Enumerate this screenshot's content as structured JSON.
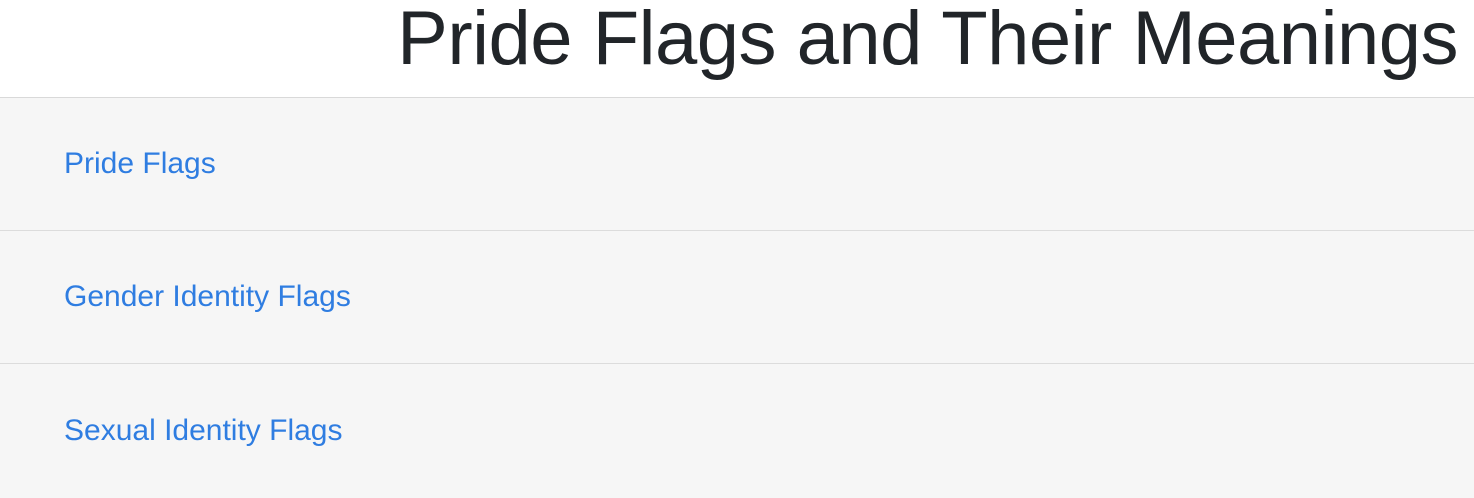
{
  "header": {
    "title": "Pride Flags and Their Meanings"
  },
  "nav": {
    "items": [
      {
        "label": "Pride Flags"
      },
      {
        "label": "Gender Identity Flags"
      },
      {
        "label": "Sexual Identity Flags"
      }
    ]
  },
  "colors": {
    "link": "#2f7de1",
    "title": "#212529",
    "list_background": "#f6f6f6",
    "divider": "#dcdcdc"
  }
}
